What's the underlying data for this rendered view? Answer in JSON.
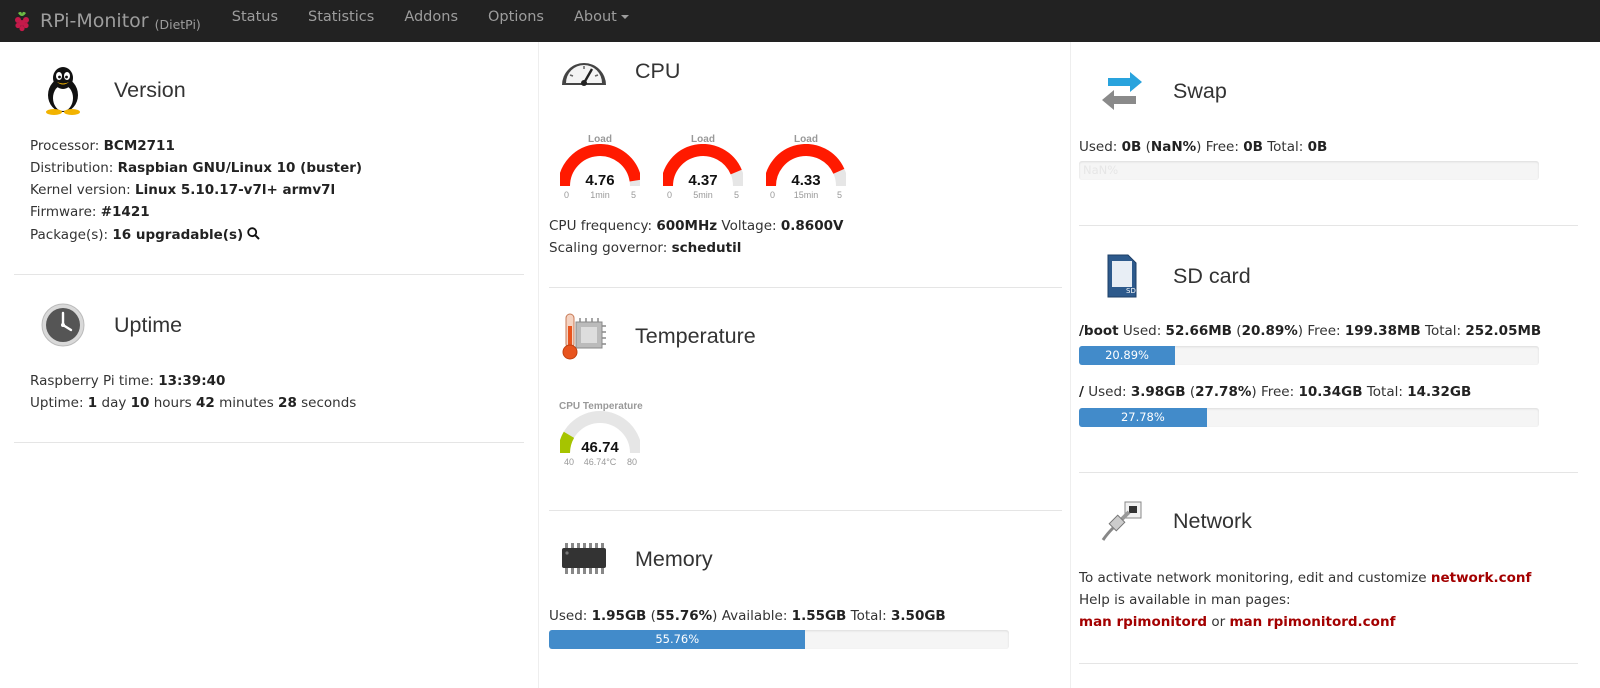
{
  "navbar": {
    "brand": "RPi-Monitor",
    "host": "(DietPi)",
    "items": [
      "Status",
      "Statistics",
      "Addons",
      "Options",
      "About"
    ]
  },
  "version": {
    "title": "Version",
    "processor_label": "Processor:",
    "processor": "BCM2711",
    "distribution_label": "Distribution:",
    "distribution": "Raspbian GNU/Linux 10 (buster)",
    "kernel_label": "Kernel version:",
    "kernel": "Linux 5.10.17-v7l+ armv7l",
    "firmware_label": "Firmware:",
    "firmware": "#1421",
    "packages_label": "Package(s):",
    "packages": "16 upgradable(s)"
  },
  "uptime": {
    "title": "Uptime",
    "time_label": "Raspberry Pi time:",
    "time": "13:39:40",
    "uptime_label": "Uptime:",
    "days": "1",
    "days_unit": "day",
    "hours": "10",
    "hours_unit": "hours",
    "minutes": "42",
    "minutes_unit": "minutes",
    "seconds": "28",
    "seconds_unit": "seconds"
  },
  "cpu": {
    "title": "CPU",
    "gauges": [
      {
        "title": "Load",
        "value": "4.76",
        "label": "1min",
        "min": "0",
        "max": "5",
        "fraction": 0.952
      },
      {
        "title": "Load",
        "value": "4.37",
        "label": "5min",
        "min": "0",
        "max": "5",
        "fraction": 0.874
      },
      {
        "title": "Load",
        "value": "4.33",
        "label": "15min",
        "min": "0",
        "max": "5",
        "fraction": 0.866
      }
    ],
    "freq_label": "CPU frequency:",
    "freq": "600MHz",
    "voltage_label": "Voltage:",
    "voltage": "0.8600V",
    "governor_label": "Scaling governor:",
    "governor": "schedutil"
  },
  "temperature": {
    "title": "Temperature",
    "gauge": {
      "title": "CPU Temperature",
      "value": "46.74",
      "label": "46.74°C",
      "min": "40",
      "max": "80",
      "fraction": 0.1685
    }
  },
  "memory": {
    "title": "Memory",
    "used_label": "Used:",
    "used": "1.95GB",
    "percent_open": "(",
    "percent": "55.76%",
    "percent_close": ")",
    "available_label": "Available:",
    "available": "1.55GB",
    "total_label": "Total:",
    "total": "3.50GB",
    "bar_label": "55.76%",
    "fraction": 0.5576
  },
  "swap": {
    "title": "Swap",
    "used_label": "Used:",
    "used": "0B",
    "percent_open": "(",
    "percent": "NaN%",
    "percent_close": ")",
    "free_label": "Free:",
    "free": "0B",
    "total_label": "Total:",
    "total": "0B",
    "bar_label": "NaN%",
    "fraction": 0
  },
  "sdcard": {
    "title": "SD card",
    "boot": {
      "mount": "/boot",
      "used_label": "Used:",
      "used": "52.66MB",
      "percent": "20.89%",
      "free_label": "Free:",
      "free": "199.38MB",
      "total_label": "Total:",
      "total": "252.05MB",
      "bar_label": "20.89%",
      "fraction": 0.2089
    },
    "root": {
      "mount": "/",
      "used_label": "Used:",
      "used": "3.98GB",
      "percent": "27.78%",
      "free_label": "Free:",
      "free": "10.34GB",
      "total_label": "Total:",
      "total": "14.32GB",
      "bar_label": "27.78%",
      "fraction": 0.2778
    }
  },
  "network": {
    "title": "Network",
    "line1": "To activate network monitoring, edit and customize",
    "link_conf": "network.conf",
    "line2": "Help is available in man pages:",
    "link_man1": "man rpimonitord",
    "or": "or",
    "link_man2": "man rpimonitord.conf"
  },
  "colors": {
    "navbar_bg": "#222222",
    "progress": "#428bca",
    "gauge_red": "#ff1a00",
    "gauge_temp": "#a6c400",
    "gauge_track": "#e6e6e6",
    "link": "#a30000"
  }
}
